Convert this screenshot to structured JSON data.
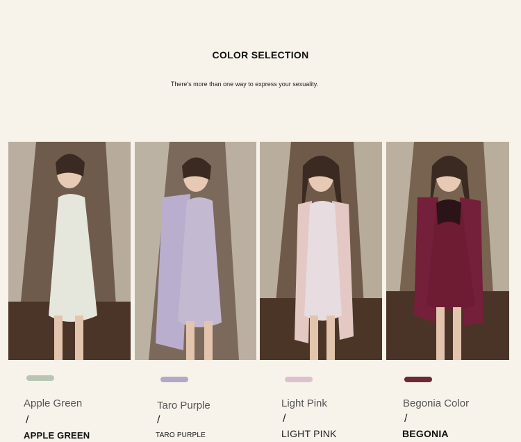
{
  "header": {
    "title": "COLOR SELECTION",
    "subtitle": "There's more than one way to express your sexuality."
  },
  "colors": [
    {
      "name": "Apple Green",
      "slash": "/",
      "code": "APPLE GREEN",
      "swatch": "#b8c7b4",
      "garment": "#e6e7dc",
      "robe": "#e9e6dc"
    },
    {
      "name": "Taro Purple",
      "slash": "/",
      "code": "TARO PURPLE",
      "swatch": "#b4a8c6",
      "garment": "#c3bad2",
      "robe": "#b9aecd"
    },
    {
      "name": "Light Pink",
      "slash": "/",
      "code": "LIGHT PINK",
      "swatch": "#ddc1cf",
      "garment": "#e7dce0",
      "robe": "#e3c8c4"
    },
    {
      "name": "Begonia Color",
      "slash": "/",
      "code": "BEGONIA",
      "swatch": "#6b2a36",
      "garment": "#6e1c34",
      "robe": "#74203a"
    }
  ]
}
